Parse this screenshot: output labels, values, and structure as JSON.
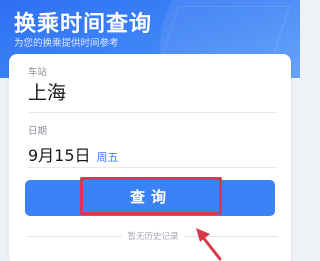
{
  "header": {
    "title": "换乘时间查询",
    "subtitle": "为您的换乘提供时间参考"
  },
  "station": {
    "label": "车站",
    "value": "上海"
  },
  "date": {
    "label": "日期",
    "value": "9月15日",
    "weekday": "周五"
  },
  "query_button": {
    "label": "查询"
  },
  "history": {
    "empty_text": "暂无历史记录"
  },
  "colors": {
    "header_blue": "#3f85f7",
    "button_blue": "#3b82f6",
    "highlight_red": "#d63a4b",
    "weekday_blue": "#3a7ef5"
  },
  "icons": {
    "annotation_arrow": "arrow-up-left-icon"
  }
}
